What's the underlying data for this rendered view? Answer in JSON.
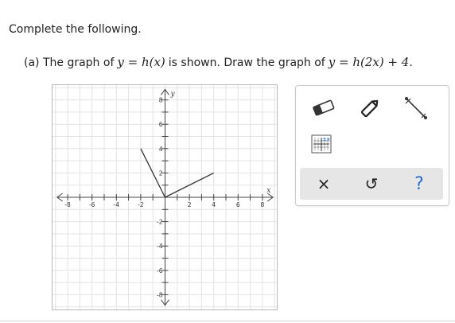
{
  "instructions": "Complete the following.",
  "part_a": {
    "prefix": "(a) The graph of",
    "eq1": "y = h(x)",
    "middle": "is shown. Draw the graph of",
    "eq2": "y = h(2x) + 4",
    "suffix": "."
  },
  "graph": {
    "x_axis_label": "x",
    "y_axis_label": "y",
    "x_tick_labels": [
      "-8",
      "-6",
      "-4",
      "-2",
      "2",
      "4",
      "6",
      "8"
    ],
    "y_tick_labels": [
      "8",
      "6",
      "4",
      "2",
      "-2",
      "-4",
      "-6",
      "-8"
    ],
    "curve_color": "#333333"
  },
  "chart_data": {
    "type": "line",
    "title": "",
    "xlabel": "x",
    "ylabel": "y",
    "xlim": [
      -9,
      9
    ],
    "ylim": [
      -9,
      9
    ],
    "grid": true,
    "series": [
      {
        "x": [
          -2,
          0,
          4
        ],
        "y": [
          4,
          0,
          2
        ]
      }
    ]
  },
  "toolbar": {
    "tools": [
      "eraser-icon",
      "pencil-icon",
      "line-segment-icon",
      "graph-settings-icon"
    ],
    "actions": {
      "clear": "×",
      "undo": "↺",
      "help": "?"
    }
  }
}
